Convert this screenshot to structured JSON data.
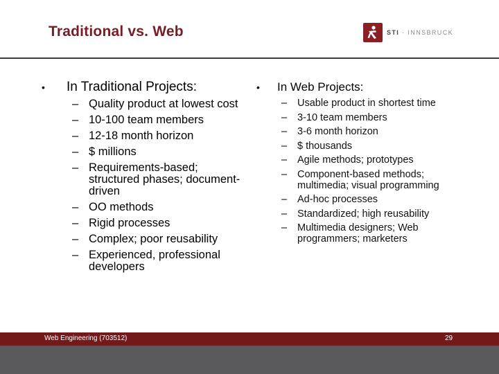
{
  "slide": {
    "title": "Traditional vs. Web",
    "logo": {
      "icon": "running-figure-icon",
      "brand": "STI",
      "separator": " · ",
      "location": "INNSBRUCK",
      "color": "#8b1f24"
    },
    "title_color": "#7a1c25"
  },
  "left_column": {
    "bullet": "•",
    "heading": "In Traditional Projects:",
    "dash": "–",
    "items": [
      "Quality product at lowest cost",
      "10-100 team members",
      "12-18 month horizon",
      "$ millions",
      "Requirements-based; structured phases; document-driven",
      "OO methods",
      "Rigid processes",
      "Complex; poor reusability",
      "Experienced, professional developers"
    ]
  },
  "right_column": {
    "bullet": "•",
    "heading": "In Web Projects:",
    "dash": "–",
    "items": [
      "Usable product in shortest time",
      "3-10 team members",
      "3-6 month horizon",
      "$ thousands",
      "Agile methods; prototypes",
      "Component-based methods; multimedia; visual programming",
      "Ad-hoc processes",
      "Standardized; high reusability",
      "Multimedia designers; Web programmers; marketers"
    ]
  },
  "footer": {
    "course": "Web Engineering (703512)",
    "page_number": "29",
    "bar_color": "#731919",
    "base_color": "#5a5a5c"
  }
}
